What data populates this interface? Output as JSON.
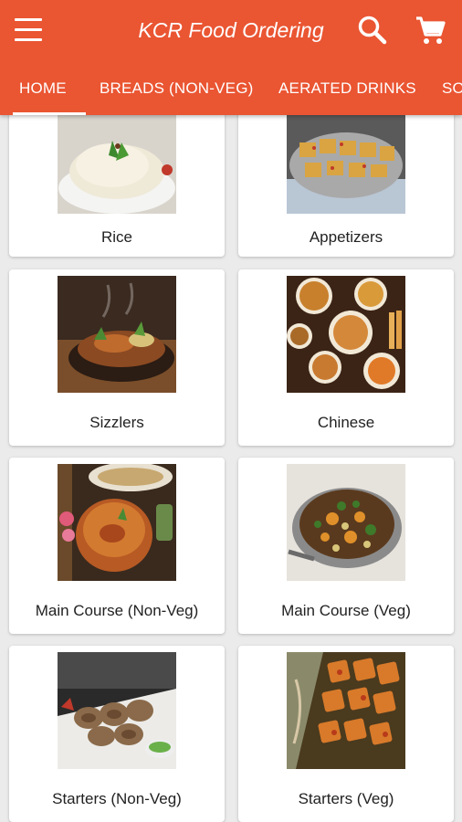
{
  "app": {
    "title": "KCR Food Ordering"
  },
  "toolbar": {
    "menu_icon": "menu-icon",
    "search_icon": "search-icon",
    "cart_icon": "cart-icon"
  },
  "tabs": [
    {
      "label": "HOME",
      "active": true
    },
    {
      "label": "BREADS (NON-VEG)",
      "active": false
    },
    {
      "label": "AERATED DRINKS",
      "active": false
    },
    {
      "label": "SO",
      "active": false
    }
  ],
  "colors": {
    "primary": "#ea5532",
    "background": "#ebebeb",
    "card": "#ffffff"
  },
  "categories": [
    {
      "label": "Rice"
    },
    {
      "label": "Appetizers"
    },
    {
      "label": "Sizzlers"
    },
    {
      "label": "Chinese"
    },
    {
      "label": "Main Course (Non-Veg)"
    },
    {
      "label": "Main Course (Veg)"
    },
    {
      "label": "Starters (Non-Veg)"
    },
    {
      "label": "Starters (Veg)"
    }
  ]
}
